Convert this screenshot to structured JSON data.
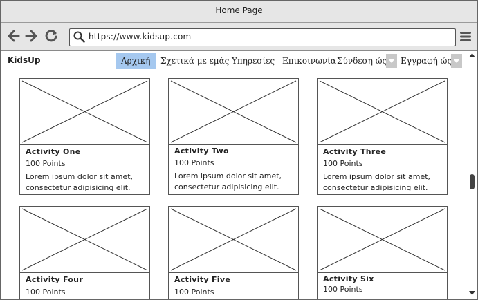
{
  "window": {
    "title": "Home Page"
  },
  "browser": {
    "url": "https://www.kidsup.com"
  },
  "site": {
    "brand": "KidsUp",
    "nav": {
      "home": "Αρχική",
      "about": "Σχετικά με εμάς",
      "services": "Υπηρεσίες",
      "contact": "Επικοινωνία",
      "login": "Σύνδεση ώς",
      "register": "Εγγραφή ώς"
    }
  },
  "activities": [
    {
      "title": "Activity One",
      "points": "100 Points",
      "desc": "Lorem ipsum dolor sit amet, consectetur adipisicing elit."
    },
    {
      "title": "Activity Two",
      "points": "100 Points",
      "desc": "Lorem ipsum dolor sit amet, consectetur adipisicing elit."
    },
    {
      "title": "Activity Three",
      "points": "100 Points",
      "desc": "Lorem ipsum dolor sit amet, consectetur adipisicing elit."
    },
    {
      "title": "Activity Four",
      "points": "100 Points",
      "desc": ""
    },
    {
      "title": "Activity Five",
      "points": "100 Points",
      "desc": ""
    },
    {
      "title": "Activity Six",
      "points": "100 Points",
      "desc": ""
    }
  ],
  "colors": {
    "active_nav": "#a5c8ef",
    "chrome": "#e6e6e6",
    "dropdown": "#c8c8c8"
  },
  "icons": [
    "back-arrow-icon",
    "forward-arrow-icon",
    "reload-icon",
    "search-icon",
    "hamburger-menu-icon",
    "chevron-down-icon",
    "image-placeholder-icon"
  ]
}
